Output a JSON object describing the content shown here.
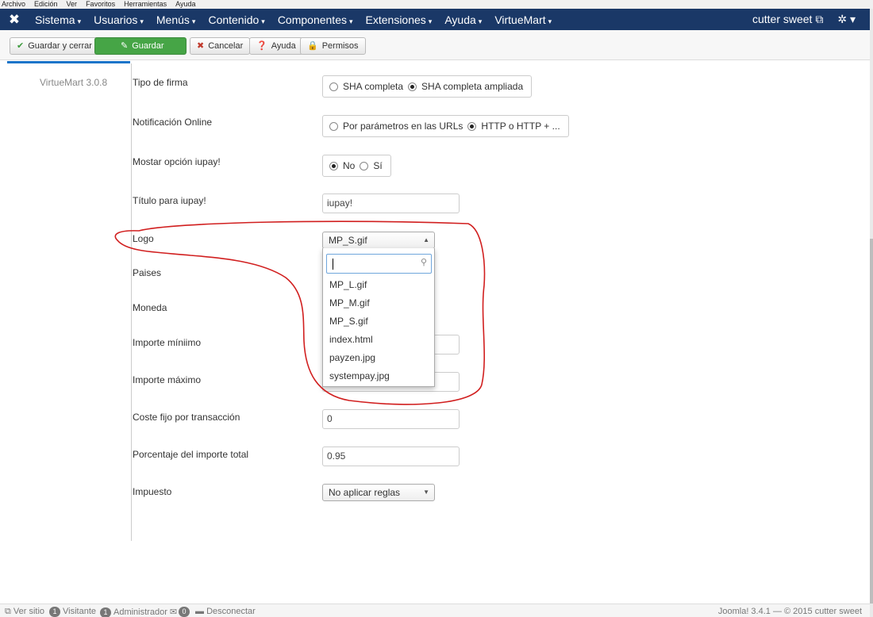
{
  "browser_menu": [
    "Archivo",
    "Edición",
    "Ver",
    "Favoritos",
    "Herramientas",
    "Ayuda"
  ],
  "navbar": {
    "items": [
      {
        "label": "Sistema"
      },
      {
        "label": "Usuarios"
      },
      {
        "label": "Menús"
      },
      {
        "label": "Contenido"
      },
      {
        "label": "Componentes"
      },
      {
        "label": "Extensiones"
      },
      {
        "label": "Ayuda"
      },
      {
        "label": "VirtueMart"
      }
    ],
    "user": "cutter sweet"
  },
  "toolbar": {
    "save_close": "Guardar y cerrar",
    "save": "Guardar",
    "cancel": "Cancelar",
    "help": "Ayuda",
    "permissions": "Permisos"
  },
  "sidebar": {
    "version": "VirtueMart 3.0.8"
  },
  "form": {
    "tipo_firma": {
      "label": "Tipo de firma",
      "options": [
        "SHA completa",
        "SHA completa ampliada"
      ],
      "selected": "SHA completa ampliada"
    },
    "notificacion": {
      "label": "Notificación Online",
      "options": [
        "Por parámetros en las URLs",
        "HTTP o HTTP + ..."
      ],
      "selected": "HTTP o HTTP + ..."
    },
    "mostrar_iupay": {
      "label": "Mostar opción iupay!",
      "options": [
        "No",
        "Sí"
      ],
      "selected": "No"
    },
    "titulo_iupay": {
      "label": "Título para iupay!",
      "value": "iupay!"
    },
    "logo": {
      "label": "Logo",
      "value": "MP_S.gif",
      "options": [
        "MP_L.gif",
        "MP_M.gif",
        "MP_S.gif",
        "index.html",
        "payzen.jpg",
        "systempay.jpg"
      ]
    },
    "paises": {
      "label": "Paises"
    },
    "moneda": {
      "label": "Moneda"
    },
    "importe_minimo": {
      "label": "Importe míniimo",
      "value": ""
    },
    "importe_maximo": {
      "label": "Importe máximo",
      "value": ""
    },
    "coste_fijo": {
      "label": "Coste fijo por transacción",
      "value": "0"
    },
    "porcentaje": {
      "label": "Porcentaje del importe total",
      "value": "0.95"
    },
    "impuesto": {
      "label": "Impuesto",
      "value": "No aplicar reglas"
    }
  },
  "footer": {
    "ver_sitio": "Ver sitio",
    "visitante_count": "1",
    "visitante": "Visitante",
    "admin_count": "1",
    "admin": "Administrador",
    "mail_count": "0",
    "logout": "Desconectar",
    "copyright": "Joomla! 3.4.1 — © 2015 cutter sweet"
  },
  "colors": {
    "navbar": "#1a3867",
    "success": "#46a546",
    "annotation": "#d11f1f",
    "accent": "#1a74c9"
  }
}
